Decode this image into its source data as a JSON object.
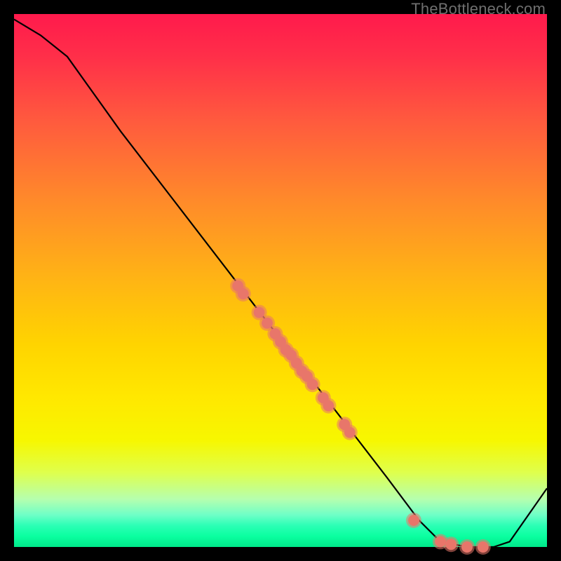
{
  "watermark": "TheBottleneck.com",
  "chart_data": {
    "type": "line",
    "title": "",
    "xlabel": "",
    "ylabel": "",
    "xlim": [
      0,
      100
    ],
    "ylim": [
      0,
      100
    ],
    "curve": [
      {
        "x": 0,
        "y": 99
      },
      {
        "x": 5,
        "y": 96
      },
      {
        "x": 10,
        "y": 92
      },
      {
        "x": 15,
        "y": 85
      },
      {
        "x": 20,
        "y": 78
      },
      {
        "x": 30,
        "y": 65
      },
      {
        "x": 40,
        "y": 52
      },
      {
        "x": 50,
        "y": 39
      },
      {
        "x": 60,
        "y": 26
      },
      {
        "x": 70,
        "y": 13
      },
      {
        "x": 76,
        "y": 5
      },
      {
        "x": 80,
        "y": 1
      },
      {
        "x": 85,
        "y": 0
      },
      {
        "x": 90,
        "y": 0
      },
      {
        "x": 93,
        "y": 1
      },
      {
        "x": 100,
        "y": 11
      }
    ],
    "series": [
      {
        "name": "cluster-points",
        "points": [
          {
            "x": 42,
            "y": 49
          },
          {
            "x": 43,
            "y": 47.5
          },
          {
            "x": 46,
            "y": 44
          },
          {
            "x": 47.5,
            "y": 42
          },
          {
            "x": 49,
            "y": 40
          },
          {
            "x": 50,
            "y": 38.5
          },
          {
            "x": 51,
            "y": 37
          },
          {
            "x": 52,
            "y": 36
          },
          {
            "x": 53,
            "y": 34.5
          },
          {
            "x": 54,
            "y": 33
          },
          {
            "x": 55,
            "y": 32
          },
          {
            "x": 56,
            "y": 30.5
          },
          {
            "x": 58,
            "y": 28
          },
          {
            "x": 59,
            "y": 26.5
          },
          {
            "x": 62,
            "y": 23
          },
          {
            "x": 63,
            "y": 21.5
          },
          {
            "x": 75,
            "y": 5
          },
          {
            "x": 80,
            "y": 1
          },
          {
            "x": 82,
            "y": 0.5
          },
          {
            "x": 85,
            "y": 0
          },
          {
            "x": 88,
            "y": 0
          }
        ]
      }
    ]
  }
}
